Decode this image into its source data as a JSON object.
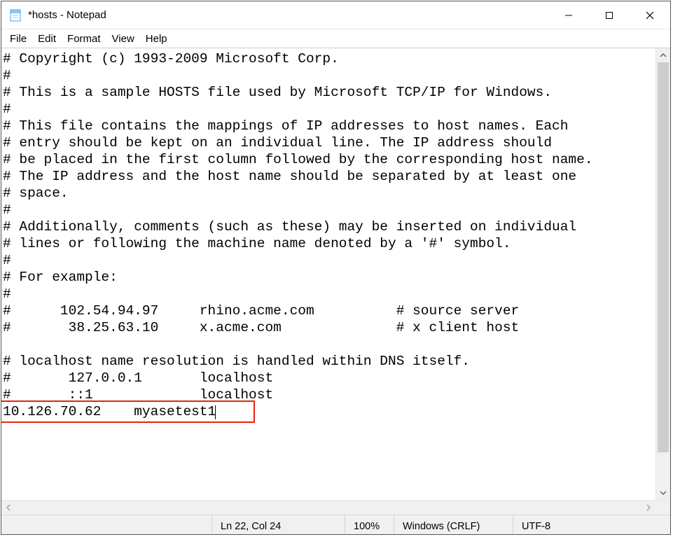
{
  "window": {
    "title": "*hosts - Notepad"
  },
  "menu": {
    "file": "File",
    "edit": "Edit",
    "format": "Format",
    "view": "View",
    "help": "Help"
  },
  "editor": {
    "lines": [
      "# Copyright (c) 1993-2009 Microsoft Corp.",
      "#",
      "# This is a sample HOSTS file used by Microsoft TCP/IP for Windows.",
      "#",
      "# This file contains the mappings of IP addresses to host names. Each",
      "# entry should be kept on an individual line. The IP address should",
      "# be placed in the first column followed by the corresponding host name.",
      "# The IP address and the host name should be separated by at least one",
      "# space.",
      "#",
      "# Additionally, comments (such as these) may be inserted on individual",
      "# lines or following the machine name denoted by a '#' symbol.",
      "#",
      "# For example:",
      "#",
      "#      102.54.94.97     rhino.acme.com          # source server",
      "#       38.25.63.10     x.acme.com              # x client host",
      "",
      "# localhost name resolution is handled within DNS itself.",
      "#       127.0.0.1       localhost",
      "#       ::1             localhost",
      "10.126.70.62    myasetest1"
    ],
    "highlight_line_index": 21
  },
  "statusbar": {
    "position": "Ln 22, Col 24",
    "zoom": "100%",
    "line_ending": "Windows (CRLF)",
    "encoding": "UTF-8"
  }
}
